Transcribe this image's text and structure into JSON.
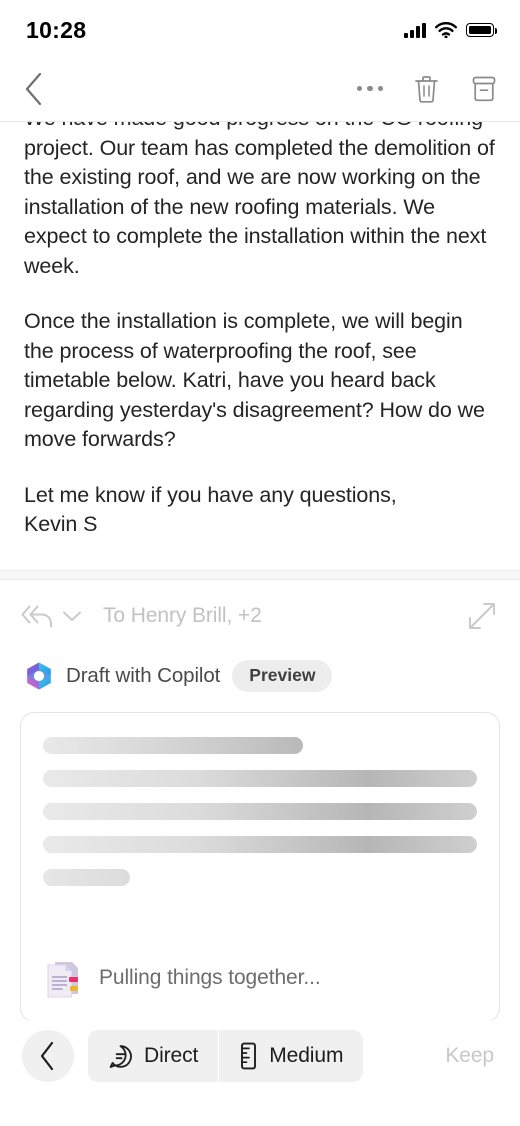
{
  "status_bar": {
    "time": "10:28",
    "signal_icon": "cellular-signal-icon",
    "wifi_icon": "wifi-icon",
    "battery_icon": "battery-full-icon"
  },
  "nav_bar": {
    "back_icon": "chevron-left-icon",
    "more_icon": "ellipsis-icon",
    "delete_icon": "trash-icon",
    "archive_icon": "archive-icon"
  },
  "email": {
    "paragraphs": [
      "We have made good progress on the CG roofing project. Our team has completed the demolition of the existing roof, and we are now working on the installation of the new roofing materials. We expect to complete the installation within the next week.",
      "Once the installation is complete, we will begin the process of waterproofing the roof, see timetable below. Katri, have you heard back regarding yesterday's disagreement? How do we move forwards?",
      "Let me know if you have any questions,\nKevin S"
    ],
    "expand_quoted_icon": "ellipsis-icon"
  },
  "reply_bar": {
    "reply_all_icon": "reply-all-icon",
    "dropdown_icon": "chevron-down-icon",
    "recipients": "To Henry Brill, +2",
    "expand_icon": "expand-diagonal-icon"
  },
  "copilot": {
    "logo_icon": "copilot-logo-icon",
    "title": "Draft with Copilot",
    "badge": "Preview",
    "skeleton_widths": [
      "60%",
      "100%",
      "100%",
      "100%",
      "20%"
    ],
    "status_icon": "documents-icon",
    "status_text": "Pulling things together..."
  },
  "toolbar": {
    "back_icon": "chevron-left-icon",
    "tone": {
      "icon": "speech-bubble-icon",
      "label": "Direct"
    },
    "length": {
      "icon": "ruler-icon",
      "label": "Medium"
    },
    "keep_label": "Keep"
  },
  "colors": {
    "text_primary": "#242424",
    "text_muted": "#6d6d6d",
    "text_disabled": "#c8c8c8",
    "icon_gray": "#8a8a8a",
    "chip_bg": "#f0f0f0",
    "card_border": "#e3e3e3"
  }
}
